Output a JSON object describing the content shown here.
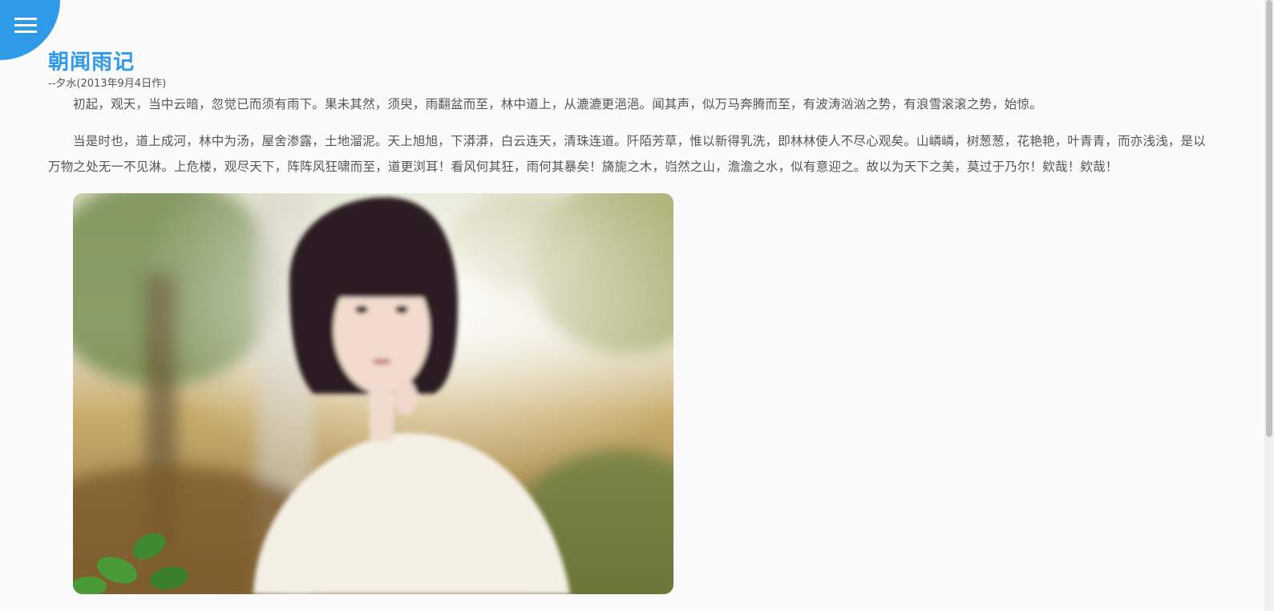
{
  "menu": {
    "icon": "hamburger-menu-icon",
    "accent": "#2f9ae8"
  },
  "article": {
    "title": "朝闻雨记",
    "byline": "--夕水(2013年9月4日作)",
    "paragraphs": [
      "初起，观天，当中云暗，忽觉已而须有雨下。果未其然，须臾，雨翻盆而至，林中道上，从漉漉更浥浥。闻其声，似万马奔腾而至，有波涛汹汹之势，有浪雪滚滚之势，始惊。",
      "当是时也，道上成河，林中为汤，屋舍渗露，土地溜泥。天上旭旭，下漭漭，白云连天，清珠连道。阡陌芳草，惟以新得乳洗，即林林使人不尽心观矣。山嶙嶙，树葱葱，花艳艳，叶青青，而亦浅浅，是以万物之处无一不见淋。上危楼，观尽天下，阵阵风狂啸而至，道更浏耳！看风何其狂，雨何其暴矣！旖旎之木，岿然之山，澹澹之水，似有意迎之。故以为天下之美，莫过于乃尔！欸哉！欸哉！"
    ]
  },
  "photo": {
    "subject": "girl-in-white-sweater-autumn-photo"
  }
}
